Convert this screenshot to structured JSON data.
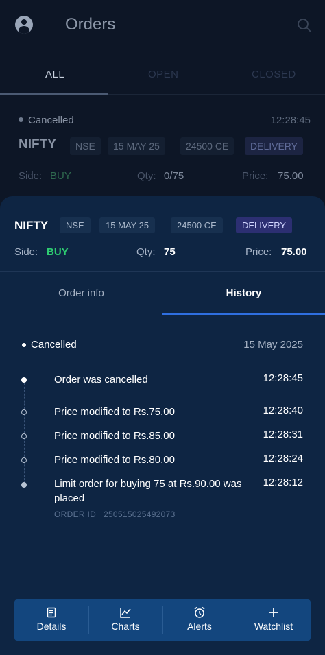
{
  "header": {
    "title": "Orders"
  },
  "tabs": {
    "all": "ALL",
    "open": "OPEN",
    "closed": "CLOSED"
  },
  "background_order": {
    "status": "Cancelled",
    "time": "12:28:45",
    "symbol": "NIFTY",
    "exchange": "NSE",
    "expiry": "15 MAY 25",
    "strike": "24500 CE",
    "product": "DELIVERY",
    "side_label": "Side:",
    "side": "BUY",
    "qty_label": "Qty:",
    "qty": "0/75",
    "price_label": "Price:",
    "price": "75.00"
  },
  "sheet": {
    "symbol": "NIFTY",
    "exchange": "NSE",
    "expiry": "15 MAY 25",
    "strike": "24500 CE",
    "product": "DELIVERY",
    "side_label": "Side:",
    "side": "BUY",
    "qty_label": "Qty:",
    "qty": "75",
    "price_label": "Price:",
    "price": "75.00",
    "tabs": {
      "info": "Order info",
      "history": "History"
    },
    "history": {
      "status": "Cancelled",
      "date": "15 May 2025",
      "events": [
        {
          "text": "Order was cancelled",
          "time": "12:28:45"
        },
        {
          "text": "Price modified to Rs.75.00",
          "time": "12:28:40"
        },
        {
          "text": "Price modified to Rs.85.00",
          "time": "12:28:31"
        },
        {
          "text": "Price modified to Rs.80.00",
          "time": "12:28:24"
        },
        {
          "text": "Limit order for buying 75 at Rs.90.00 was placed",
          "time": "12:28:12"
        }
      ],
      "order_id": "ORDER ID   250515025492073"
    }
  },
  "actions": {
    "details": "Details",
    "charts": "Charts",
    "alerts": "Alerts",
    "watchlist": "Watchlist"
  },
  "colors": {
    "accent": "#2f6fe0",
    "buy": "#2ecc71",
    "sheet_bg": "#0e2543",
    "action_bar": "#13467e"
  }
}
